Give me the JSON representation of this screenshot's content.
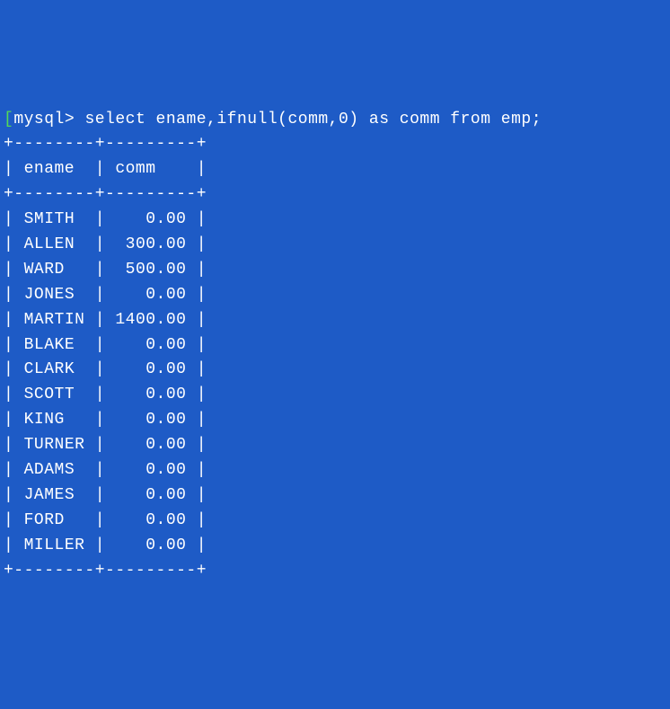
{
  "prompt": {
    "bracket": "[",
    "shell": "mysql> ",
    "query": "select ename,ifnull(comm,0) as comm from emp;"
  },
  "table": {
    "headers": [
      "ename",
      "comm"
    ],
    "col1_width": 8,
    "col2_width": 9,
    "rows": [
      {
        "ename": "SMITH",
        "comm": "0.00"
      },
      {
        "ename": "ALLEN",
        "comm": "300.00"
      },
      {
        "ename": "WARD",
        "comm": "500.00"
      },
      {
        "ename": "JONES",
        "comm": "0.00"
      },
      {
        "ename": "MARTIN",
        "comm": "1400.00"
      },
      {
        "ename": "BLAKE",
        "comm": "0.00"
      },
      {
        "ename": "CLARK",
        "comm": "0.00"
      },
      {
        "ename": "SCOTT",
        "comm": "0.00"
      },
      {
        "ename": "KING",
        "comm": "0.00"
      },
      {
        "ename": "TURNER",
        "comm": "0.00"
      },
      {
        "ename": "ADAMS",
        "comm": "0.00"
      },
      {
        "ename": "JAMES",
        "comm": "0.00"
      },
      {
        "ename": "FORD",
        "comm": "0.00"
      },
      {
        "ename": "MILLER",
        "comm": "0.00"
      }
    ]
  }
}
